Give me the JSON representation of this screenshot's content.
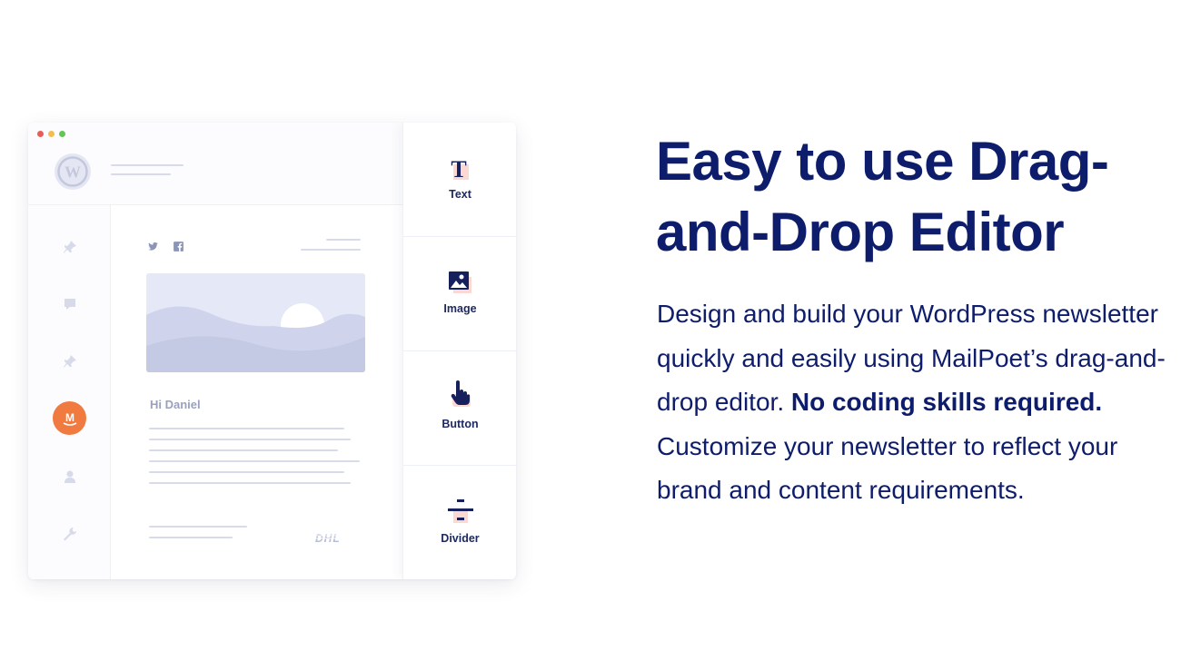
{
  "window": {
    "dot_colors": [
      "#ec5c57",
      "#f4be4f",
      "#62c655"
    ],
    "greeting": "Hi Daniel",
    "sender_logo": "DHL",
    "sidebar_icons": [
      "pin-icon",
      "comment-icon",
      "pin-icon",
      "mailpoet-icon",
      "user-icon",
      "wrench-icon"
    ],
    "mailpoet_badge_letter": "M"
  },
  "blocks": [
    {
      "label": "Text",
      "icon": "text-icon"
    },
    {
      "label": "Image",
      "icon": "image-icon"
    },
    {
      "label": "Button",
      "icon": "pointer-icon"
    },
    {
      "label": "Divider",
      "icon": "divider-icon"
    }
  ],
  "copy": {
    "headline": "Easy to use Drag-and-Drop Editor",
    "body_part1": "Design and build your WordPress newsletter quickly and easily using MailPoet’s drag-and-drop editor. ",
    "body_bold": "No coding skills required.",
    "body_part2": " Customize your newsletter to reflect your brand and content requirements."
  },
  "colors": {
    "navy": "#0e1d6b",
    "accent_pink": "#fbd8d2",
    "mailpoet_orange": "#f07a3f"
  }
}
